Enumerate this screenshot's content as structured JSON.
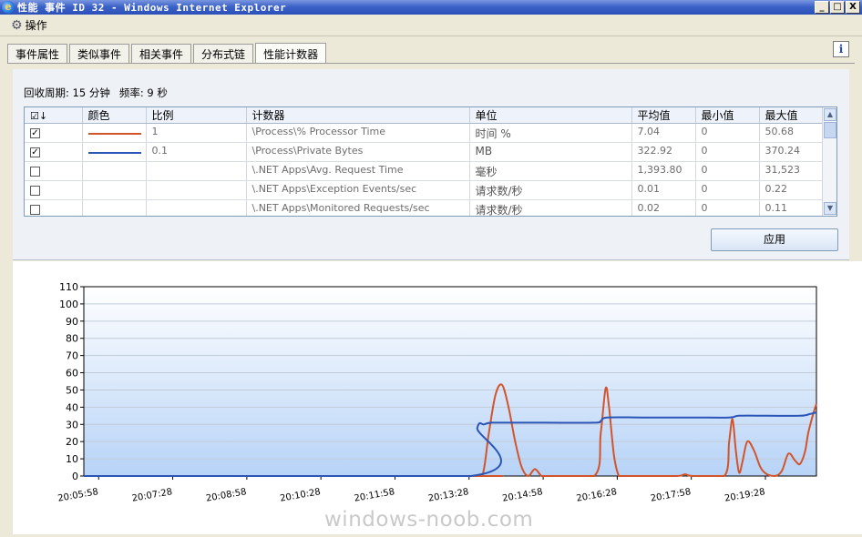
{
  "window": {
    "title": "性能 事件 ID 32 - Windows Internet Explorer",
    "icon": "ie-icon",
    "controls": {
      "minimize": "_",
      "restore": "□",
      "close": "X"
    }
  },
  "actions": {
    "operate_label": "操作"
  },
  "tabs": [
    {
      "label": "事件属性",
      "active": false
    },
    {
      "label": "类似事件",
      "active": false
    },
    {
      "label": "相关事件",
      "active": false
    },
    {
      "label": "分布式链",
      "active": false
    },
    {
      "label": "性能计数器",
      "active": true
    }
  ],
  "help_glyph": "i",
  "collection": {
    "period": "回收周期: 15 分钟",
    "frequency": "频率: 9 秒"
  },
  "grid": {
    "columns": [
      "颜色",
      "比例",
      "计数器",
      "单位",
      "平均值",
      "最小值",
      "最大值"
    ],
    "rows": [
      {
        "checked": true,
        "color": "#d2542a",
        "scale": "1",
        "counter": "\\Process\\% Processor Time",
        "unit": "时间 %",
        "avg": "7.04",
        "min": "0",
        "max": "50.68"
      },
      {
        "checked": true,
        "color": "#2b56b8",
        "scale": "0.1",
        "counter": "\\Process\\Private Bytes",
        "unit": "MB",
        "avg": "322.92",
        "min": "0",
        "max": "370.24"
      },
      {
        "checked": false,
        "color": "",
        "scale": "",
        "counter": "\\.NET Apps\\Avg. Request Time",
        "unit": "毫秒",
        "avg": "1,393.80",
        "min": "0",
        "max": "31,523"
      },
      {
        "checked": false,
        "color": "",
        "scale": "",
        "counter": "\\.NET Apps\\Exception Events/sec",
        "unit": "请求数/秒",
        "avg": "0.01",
        "min": "0",
        "max": "0.22"
      },
      {
        "checked": false,
        "color": "",
        "scale": "",
        "counter": "\\.NET Apps\\Monitored Requests/sec",
        "unit": "请求数/秒",
        "avg": "0.02",
        "min": "0",
        "max": "0.11"
      }
    ]
  },
  "apply_label": "应用",
  "watermark": "windows-noob.com",
  "chart_data": {
    "type": "line",
    "title": "",
    "xlabel": "",
    "ylabel": "",
    "ylim": [
      0,
      110
    ],
    "yticks": [
      0,
      10,
      20,
      30,
      40,
      50,
      60,
      70,
      80,
      90,
      100,
      110
    ],
    "xlim": [
      "20:05:40",
      "20:20:30"
    ],
    "xtick_labels": [
      "20:05:58",
      "20:07:28",
      "20:08:58",
      "20:10:28",
      "20:11:58",
      "20:13:28",
      "20:14:58",
      "20:16:28",
      "20:17:58",
      "20:19:28"
    ],
    "grid": true,
    "series": [
      {
        "color": "#d2542a",
        "x": [
          "20:05:40",
          "20:13:30",
          "20:13:44",
          "20:13:52",
          "20:14:00",
          "20:14:08",
          "20:14:16",
          "20:14:24",
          "20:14:32",
          "20:14:40",
          "20:14:48",
          "20:14:56",
          "20:15:04",
          "20:16:00",
          "20:16:08",
          "20:16:14",
          "20:16:18",
          "20:16:24",
          "20:16:30",
          "20:16:36",
          "20:16:44",
          "20:17:40",
          "20:17:50",
          "20:18:00",
          "20:18:38",
          "20:18:44",
          "20:18:48",
          "20:18:52",
          "20:18:56",
          "20:19:00",
          "20:19:06",
          "20:19:14",
          "20:19:22",
          "20:19:30",
          "20:19:40",
          "20:19:48",
          "20:19:56",
          "20:20:04",
          "20:20:10",
          "20:20:16",
          "20:20:20",
          "20:20:26",
          "20:20:30"
        ],
        "y": [
          0,
          0,
          0,
          25,
          47,
          53,
          40,
          20,
          5,
          0,
          4,
          0,
          0,
          0,
          25,
          51,
          40,
          12,
          0,
          0,
          0,
          0,
          1,
          0,
          0,
          20,
          33,
          15,
          2,
          8,
          20,
          15,
          5,
          1,
          0,
          3,
          13,
          9,
          7,
          14,
          25,
          36,
          42
        ]
      },
      {
        "color": "#2b56b8",
        "x": [
          "20:05:40",
          "20:13:30",
          "20:13:38",
          "20:13:46",
          "20:13:54",
          "20:14:02",
          "20:15:00",
          "20:16:00",
          "20:16:08",
          "20:16:16",
          "20:17:00",
          "20:18:00",
          "20:18:44",
          "20:18:56",
          "20:19:30",
          "20:20:10",
          "20:20:22",
          "20:20:30"
        ],
        "y": [
          0,
          0,
          28,
          30,
          31,
          31,
          31,
          31,
          32,
          34,
          34,
          34,
          34,
          35,
          35,
          35,
          36,
          37
        ]
      }
    ]
  }
}
